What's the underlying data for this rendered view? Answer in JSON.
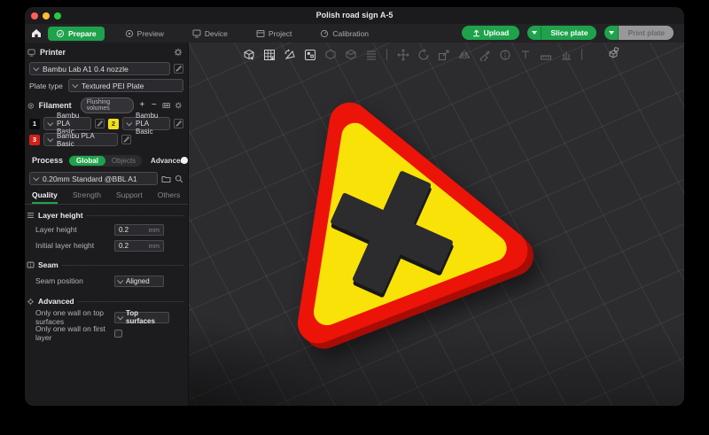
{
  "colors": {
    "accent_green": "#1fa24c",
    "light_red": "#ff5f57",
    "light_yellow": "#febc2e",
    "light_green": "#28c840",
    "sign_red": "#ec1308",
    "sign_red_dark": "#a80c05",
    "sign_yellow": "#f9e207",
    "sign_cross": "#2c2c2e",
    "sign_cross_dark": "#18181a"
  },
  "titlebar": {
    "title": "Polish road sign A-5"
  },
  "nav": {
    "tabs": [
      {
        "label": "Prepare"
      },
      {
        "label": "Preview"
      },
      {
        "label": "Device"
      },
      {
        "label": "Project"
      },
      {
        "label": "Calibration"
      }
    ],
    "active_tab": "Prepare",
    "upload_label": "Upload",
    "slice_label": "Slice plate",
    "print_label": "Print plate"
  },
  "printer": {
    "section_title": "Printer",
    "preset": "Bambu Lab A1 0.4 nozzle",
    "plate_type_label": "Plate type",
    "plate_type_value": "Textured PEI Plate"
  },
  "filament": {
    "section_title": "Filament",
    "flushing_volumes_label": "Flushing volumes",
    "add_label": "+",
    "remove_label": "−",
    "slots": [
      {
        "index": "1",
        "name": "Bambu PLA Basic",
        "color": "#0b0b0d"
      },
      {
        "index": "2",
        "name": "Bambu PLA Basic",
        "color": "#f0e11a"
      },
      {
        "index": "3",
        "name": "Bambu PLA Basic",
        "color": "#d42016"
      }
    ]
  },
  "process": {
    "section_title": "Process",
    "scope_global": "Global",
    "scope_objects": "Objects",
    "advanced_label": "Advanced",
    "preset": "0.20mm Standard @BBL A1",
    "tabs": [
      {
        "label": "Quality"
      },
      {
        "label": "Strength"
      },
      {
        "label": "Support"
      },
      {
        "label": "Others"
      }
    ],
    "active_tab": "Quality"
  },
  "quality_settings": {
    "layer_height_group": "Layer height",
    "layer_height_label": "Layer height",
    "layer_height_value": "0.2",
    "layer_height_unit": "mm",
    "initial_layer_height_label": "Initial layer height",
    "initial_layer_height_value": "0.2",
    "initial_layer_height_unit": "mm",
    "seam_group": "Seam",
    "seam_position_label": "Seam position",
    "seam_position_value": "Aligned",
    "advanced_group": "Advanced",
    "one_wall_top_label": "Only one wall on top surfaces",
    "one_wall_top_value": "Top surfaces",
    "one_wall_first_label": "Only one wall on first layer"
  }
}
